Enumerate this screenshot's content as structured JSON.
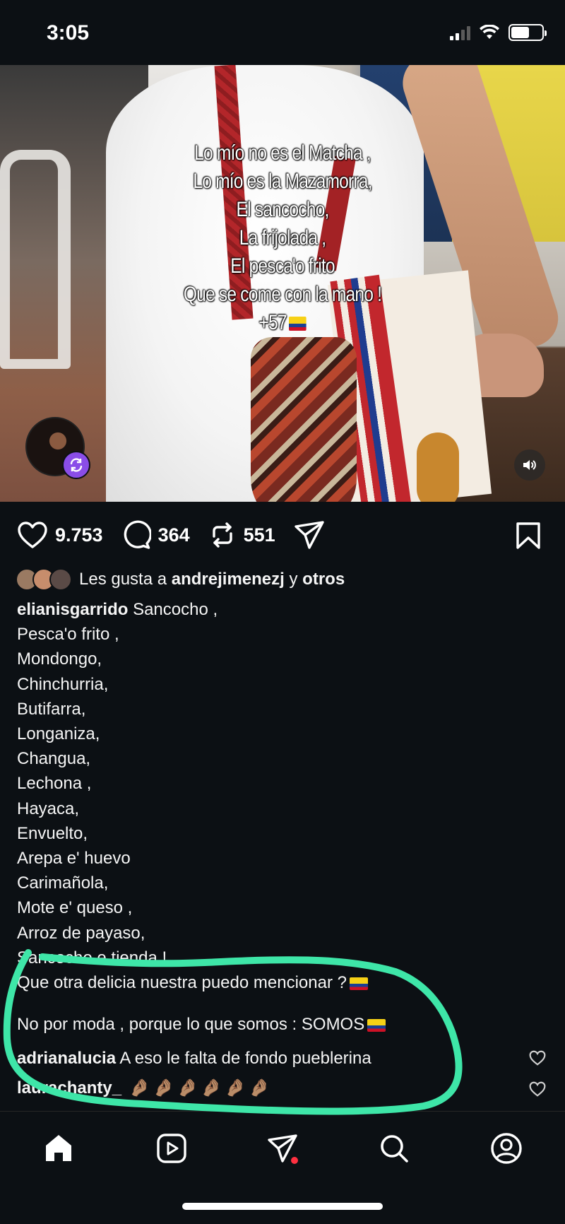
{
  "status_bar": {
    "time": "3:05",
    "battery_level": 0.6
  },
  "post": {
    "overlay_lines": [
      "Lo mío no es el Matcha ,",
      "Lo mío es la Mazamorra,",
      "El sancocho,",
      "La frijolada ,",
      "El pesca'o frito",
      "Que se come con la mano !",
      "+57"
    ],
    "likes": "9.753",
    "comments": "364",
    "reposts": "551",
    "liked_by_prefix": "Les gusta a",
    "liked_by_user": "andrejimenezj",
    "liked_by_mid": "y",
    "liked_by_others": "otros",
    "author": "elianisgarrido",
    "caption_first": "Sancocho ,",
    "caption_lines": [
      "Pesca'o frito ,",
      "Mondongo,",
      "Chinchurria,",
      "Butifarra,",
      "Longaniza,",
      "Changua,",
      "Lechona ,",
      "Hayaca,",
      "Envuelto,",
      "Arepa e' huevo",
      "Carimañola,",
      "Mote e' queso ,",
      "Arroz de payaso,",
      "Sancocho e tienda !",
      "Que otra delicia nuestra puedo mencionar ?"
    ],
    "caption_closing": "No por moda , porque lo que somos : SOMOS"
  },
  "comments": [
    {
      "user": "adrianalucia",
      "text": "A eso le falta de fondo pueblerina"
    },
    {
      "user": "laurachanty_",
      "text": ""
    }
  ],
  "colors": {
    "background": "#0c1014",
    "annotation": "#3ee6a8",
    "remix_badge": "#8a4de8",
    "notification_dot": "#ff3040"
  },
  "icons": [
    "heart-icon",
    "comment-icon",
    "repost-icon",
    "share-icon",
    "bookmark-icon",
    "home-icon",
    "reels-icon",
    "direct-icon",
    "search-icon",
    "profile-icon",
    "sound-icon",
    "remix-icon"
  ]
}
